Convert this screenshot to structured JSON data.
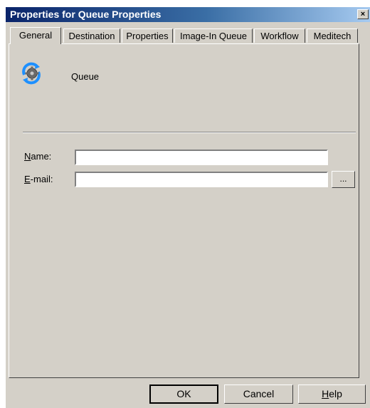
{
  "window": {
    "title": "Properties for Queue Properties",
    "close_label": "×"
  },
  "tabs": [
    {
      "label": "General",
      "active": true
    },
    {
      "label": "Destination"
    },
    {
      "label": "Properties"
    },
    {
      "label": "Image-In Queue"
    },
    {
      "label": "Workflow"
    },
    {
      "label": "Meditech"
    }
  ],
  "header": {
    "icon": "queue-gear-icon",
    "label": "Queue"
  },
  "form": {
    "name": {
      "label_first": "N",
      "label_rest": "ame:",
      "value": ""
    },
    "email": {
      "label_first": "E",
      "label_rest": "-mail:",
      "value": ""
    },
    "browse_label": "..."
  },
  "buttons": {
    "ok": "OK",
    "cancel": "Cancel",
    "help_first": "H",
    "help_rest": "elp"
  },
  "colors": {
    "dialog_bg": "#d4d0c8",
    "titlebar_start": "#0a246a",
    "titlebar_end": "#a6caf0"
  }
}
